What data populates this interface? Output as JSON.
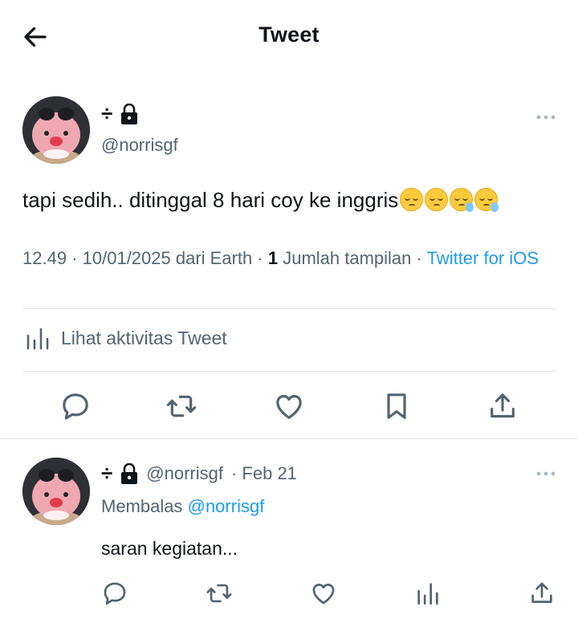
{
  "header": {
    "title": "Tweet",
    "back_icon": "arrow-left-icon"
  },
  "tweet": {
    "display_name": "÷",
    "lock_icon": "lock-icon",
    "handle": "@norrisgf",
    "text": "tapi sedih.. ditinggal 8 hari coy ke inggris",
    "emojis": [
      "pensive-face",
      "pensive-face",
      "sleepy-face",
      "sleepy-face"
    ],
    "meta": {
      "time": "12.49",
      "date": "10/01/2025",
      "location": "dari Earth",
      "views_count": "1",
      "views_label": "Jumlah tampilan",
      "client": "Twitter for iOS",
      "sep": "·"
    },
    "activity_label": "Lihat aktivitas Tweet",
    "actions": [
      "reply-icon",
      "retweet-icon",
      "like-icon",
      "bookmark-icon",
      "share-icon"
    ]
  },
  "reply": {
    "display_name": "÷",
    "handle": "@norrisgf",
    "date": "· Feb 21",
    "replying_prefix": "Membalas",
    "replying_to": "@norrisgf",
    "text": "saran kegiatan...",
    "actions": [
      "reply-icon",
      "retweet-icon",
      "like-icon",
      "views-icon",
      "share-icon"
    ]
  },
  "colors": {
    "text": "#0f1419",
    "secondary": "#536471",
    "accent": "#1d9bf0",
    "divider": "#dfe3e6"
  }
}
